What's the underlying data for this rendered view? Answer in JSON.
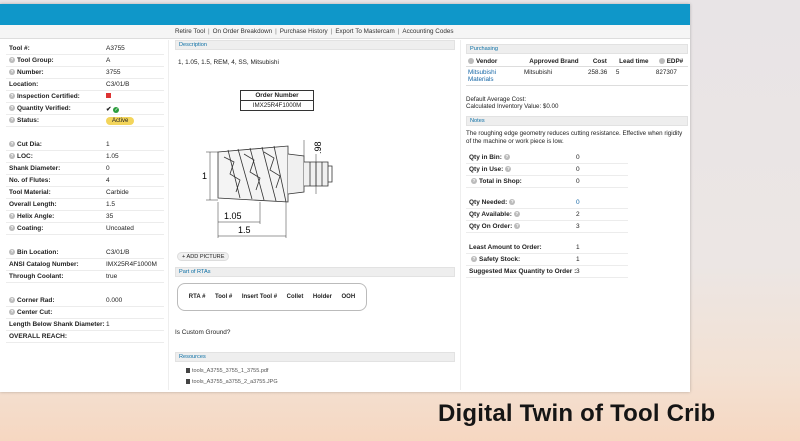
{
  "nav": {
    "items": [
      "Retire Tool",
      "On Order Breakdown",
      "Purchase History",
      "Export To Mastercam",
      "Accounting Codes"
    ]
  },
  "tool": {
    "rows": [
      {
        "label": "Tool #:",
        "value": "A3755",
        "q": false
      },
      {
        "label": "Tool Group:",
        "value": "A",
        "q": true
      },
      {
        "label": "Number:",
        "value": "3755",
        "q": true
      },
      {
        "label": "Location:",
        "value": "C3/01/B",
        "q": false
      },
      {
        "label": "Inspection Certified:",
        "value": "",
        "q": true,
        "kind": "redsq"
      },
      {
        "label": "Quantity Verified:",
        "value": "✔",
        "q": true,
        "kind": "check"
      },
      {
        "label": "Status:",
        "value": "Active",
        "q": true,
        "kind": "badge"
      },
      {
        "label": "Cut Dia:",
        "value": "1",
        "q": true
      },
      {
        "label": "LOC:",
        "value": "1.05",
        "q": true
      },
      {
        "label": "Shank Diameter:",
        "value": "0",
        "q": false
      },
      {
        "label": "No. of Flutes:",
        "value": "4",
        "q": false
      },
      {
        "label": "Tool Material:",
        "value": "Carbide",
        "q": false
      },
      {
        "label": "Overall Length:",
        "value": "1.5",
        "q": false
      },
      {
        "label": "Helix Angle:",
        "value": "35",
        "q": true
      },
      {
        "label": "Coating:",
        "value": "Uncoated",
        "q": true
      },
      {
        "label": "Bin Location:",
        "value": "C3/01/B",
        "q": true
      },
      {
        "label": "ANSI Catalog Number:",
        "value": "IMX25R4F1000M",
        "q": false
      },
      {
        "label": "Through Coolant:",
        "value": "true",
        "q": false
      },
      {
        "label": "Corner Rad:",
        "value": "0.000",
        "q": true
      },
      {
        "label": "Center Cut:",
        "value": "",
        "q": true
      },
      {
        "label": "Length Below Shank Diameter:",
        "value": "1",
        "q": false
      },
      {
        "label": "OVERALL REACH:",
        "value": "",
        "q": false
      }
    ]
  },
  "description": {
    "header": "Description",
    "text": "1, 1.05, 1.5, REM, 4, SS, Mitsubishi",
    "order_number_header": "Order Number",
    "order_number_value": "IMX25R4F1000M",
    "dims": {
      "d98": ".98",
      "d1": "1",
      "d105": "1.05",
      "d15": "1.5"
    },
    "add_picture": "+ ADD PICTURE"
  },
  "rta": {
    "header": "Part of RTAs",
    "columns": [
      "RTA #",
      "Tool #",
      "Insert Tool #",
      "Collet",
      "Holder",
      "OOH"
    ]
  },
  "custom_ground": "Is Custom Ground?",
  "resources": {
    "header": "Resources",
    "files": [
      "tools_A3755_3755_1_3755.pdf",
      "tools_A3755_a3755_2_a3755.JPG"
    ]
  },
  "purchasing": {
    "header": "Purchasing",
    "columns": [
      "Vendor",
      "Approved Brand",
      "Cost",
      "Lead time",
      "EDP#"
    ],
    "row": {
      "vendor": "Mitsubishi Materials",
      "brand": "Mitsubishi",
      "cost": "258.36",
      "lead": "5",
      "edp": "827307"
    },
    "default_avg_cost": "Default Average Cost:",
    "calc_inventory": "Calculated Inventory Value: $0.00"
  },
  "notes": {
    "header": "Notes",
    "text": "The roughing edge geometry reduces cutting resistance. Effective when rigidity of the machine or work piece is low."
  },
  "quantities": [
    {
      "label": "Qty in Bin:",
      "value": "0",
      "q": true,
      "qpos": "after"
    },
    {
      "label": "Qty in Use:",
      "value": "0",
      "q": true,
      "qpos": "after"
    },
    {
      "label": "Total in Shop:",
      "value": "0",
      "q": true,
      "qpos": "before"
    },
    {
      "label": "Qty Needed:",
      "value": "0",
      "q": true,
      "qpos": "after",
      "blue": true
    },
    {
      "label": "Qty Available:",
      "value": "2",
      "q": true,
      "qpos": "after"
    },
    {
      "label": "Qty On Order:",
      "value": "3",
      "q": true,
      "qpos": "after"
    },
    {
      "label": "Least Amount to Order:",
      "value": "1",
      "q": false
    },
    {
      "label": "Safety Stock:",
      "value": "1",
      "q": true,
      "qpos": "before"
    },
    {
      "label": "Suggested Max Quantity to Order :",
      "value": "3",
      "q": false
    }
  ],
  "caption": "Digital Twin of Tool Crib"
}
